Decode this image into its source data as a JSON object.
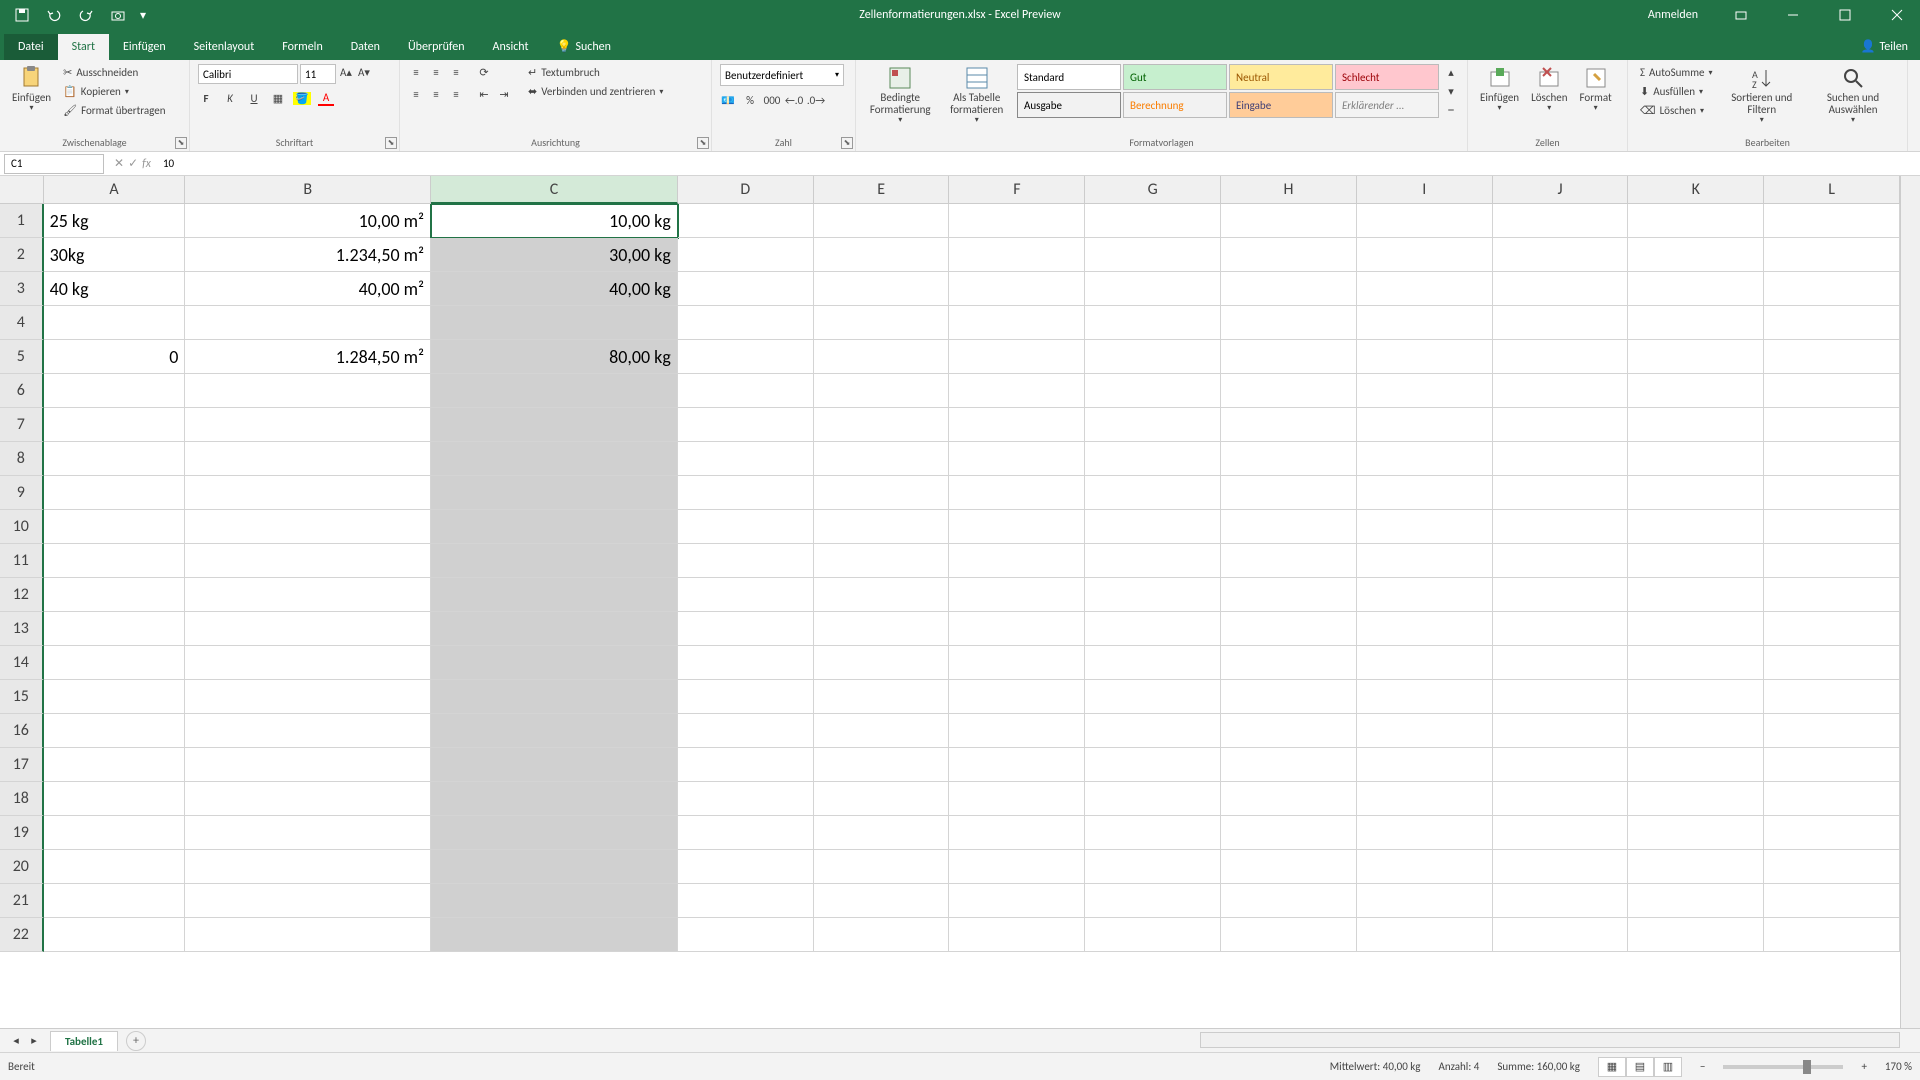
{
  "title": "Zellenformatierungen.xlsx - Excel Preview",
  "signin": "Anmelden",
  "tabs": {
    "file": "Datei",
    "home": "Start",
    "insert": "Einfügen",
    "layout": "Seitenlayout",
    "formulas": "Formeln",
    "data": "Daten",
    "review": "Überprüfen",
    "view": "Ansicht",
    "search": "Suchen",
    "share": "Teilen"
  },
  "ribbon": {
    "clipboard": {
      "paste": "Einfügen",
      "cut": "Ausschneiden",
      "copy": "Kopieren",
      "format_painter": "Format übertragen",
      "label": "Zwischenablage"
    },
    "font": {
      "name": "Calibri",
      "size": "11",
      "label": "Schriftart"
    },
    "alignment": {
      "wrap": "Textumbruch",
      "merge": "Verbinden und zentrieren",
      "label": "Ausrichtung"
    },
    "number": {
      "format": "Benutzerdefiniert",
      "label": "Zahl"
    },
    "styles": {
      "cond": "Bedingte Formatierung",
      "table": "Als Tabelle formatieren",
      "s1": "Standard",
      "s2": "Gut",
      "s3": "Neutral",
      "s4": "Schlecht",
      "s5": "Ausgabe",
      "s6": "Berechnung",
      "s7": "Eingabe",
      "s8": "Erklärender ...",
      "label": "Formatvorlagen"
    },
    "cells": {
      "insert": "Einfügen",
      "delete": "Löschen",
      "format": "Format",
      "label": "Zellen"
    },
    "editing": {
      "autosum": "AutoSumme",
      "fill": "Ausfüllen",
      "clear": "Löschen",
      "sort": "Sortieren und Filtern",
      "find": "Suchen und Auswählen",
      "label": "Bearbeiten"
    }
  },
  "name_box": "C1",
  "formula": "10",
  "columns": [
    "A",
    "B",
    "C",
    "D",
    "E",
    "F",
    "G",
    "H",
    "I",
    "J",
    "K",
    "L"
  ],
  "selected_col": "C",
  "rows": [
    1,
    2,
    3,
    4,
    5,
    6,
    7,
    8,
    9,
    10,
    11,
    12,
    13,
    14,
    15,
    16,
    17,
    18,
    19,
    20,
    21,
    22
  ],
  "cells": {
    "A1": "25 kg",
    "B1": "10,00 m²",
    "C1": "10,00 kg",
    "A2": "30kg",
    "B2": "1.234,50 m²",
    "C2": "30,00 kg",
    "A3": "40 kg",
    "B3": "40,00 m²",
    "C3": "40,00 kg",
    "A5": "0",
    "B5": "1.284,50 m²",
    "C5": "80,00 kg"
  },
  "sheet_tab": "Tabelle1",
  "status": {
    "ready": "Bereit",
    "avg": "Mittelwert: 40,00 kg",
    "count": "Anzahl: 4",
    "sum": "Summe: 160,00 kg",
    "zoom": "170 %"
  }
}
